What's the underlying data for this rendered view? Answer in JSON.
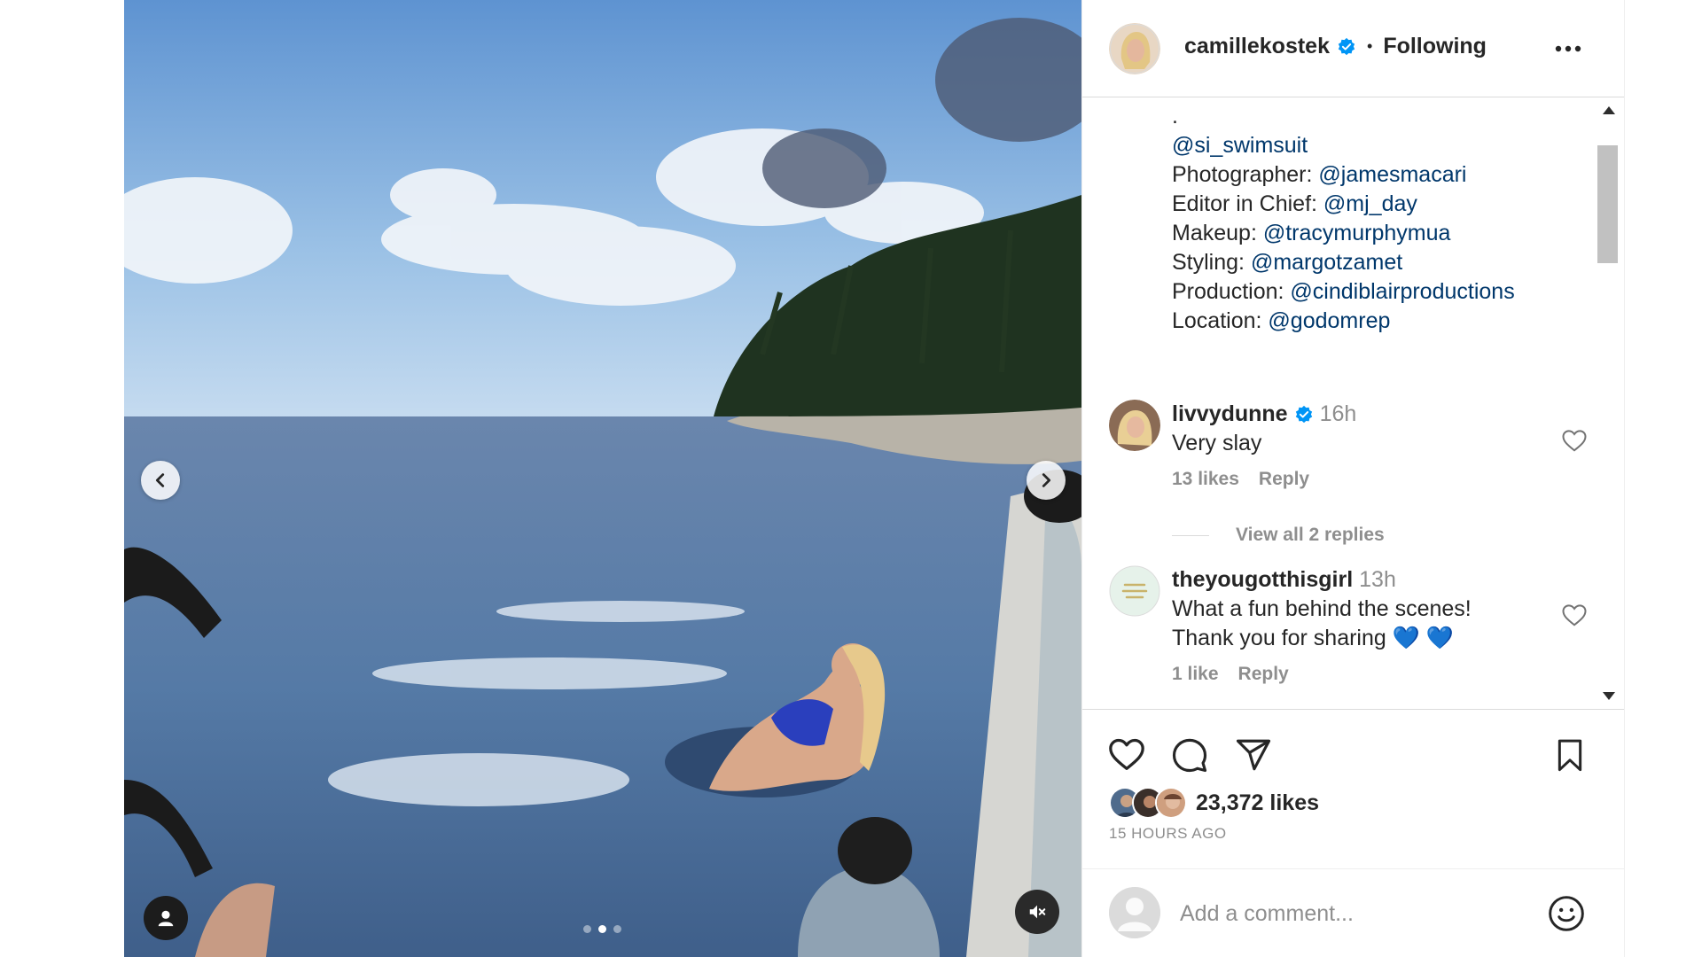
{
  "header": {
    "username": "camillekostek",
    "separator": "•",
    "follow_state": "Following",
    "more_icon": "more-horizontal-icon"
  },
  "media": {
    "carousel_count": 3,
    "carousel_active_index": 1,
    "prev_icon": "chevron-left-icon",
    "next_icon": "chevron-right-icon",
    "tag_icon": "user-tag-icon",
    "mute_icon": "speaker-muted-icon"
  },
  "caption": {
    "leading": ".",
    "mention_1": "@si_swimsuit",
    "credits": [
      {
        "label": "Photographer: ",
        "handle": "@jamesmacari"
      },
      {
        "label": "Editor in Chief: ",
        "handle": "@mj_day"
      },
      {
        "label": "Makeup: ",
        "handle": "@tracymurphymua"
      },
      {
        "label": "Styling: ",
        "handle": "@margotzamet"
      },
      {
        "label": "Production: ",
        "handle": "@cindiblairproductions"
      },
      {
        "label": "Location: ",
        "handle": "@godomrep"
      }
    ]
  },
  "comments": [
    {
      "username": "livvydunne",
      "time": "16h",
      "text": "Very slay",
      "likes": "13 likes",
      "reply": "Reply",
      "verified": true
    },
    {
      "username": "theyougotthisgirl",
      "time": "13h",
      "text_line1": "What a fun behind the scenes!",
      "text_line2": "Thank you for sharing 💙 💙",
      "likes": "1 like",
      "reply": "Reply",
      "verified": false
    }
  ],
  "view_replies": "View all 2 replies",
  "actions": {
    "like_icon": "heart-icon",
    "comment_icon": "comment-icon",
    "share_icon": "send-icon",
    "save_icon": "bookmark-icon"
  },
  "likes_count": "23,372 likes",
  "timestamp": "15 HOURS AGO",
  "add_comment": {
    "placeholder": "Add a comment...",
    "emoji_icon": "smiley-icon"
  },
  "colors": {
    "mention": "#00376b",
    "verified": "#0095f6",
    "muted_text": "#8e8e8e",
    "border": "#dbdbdb"
  }
}
